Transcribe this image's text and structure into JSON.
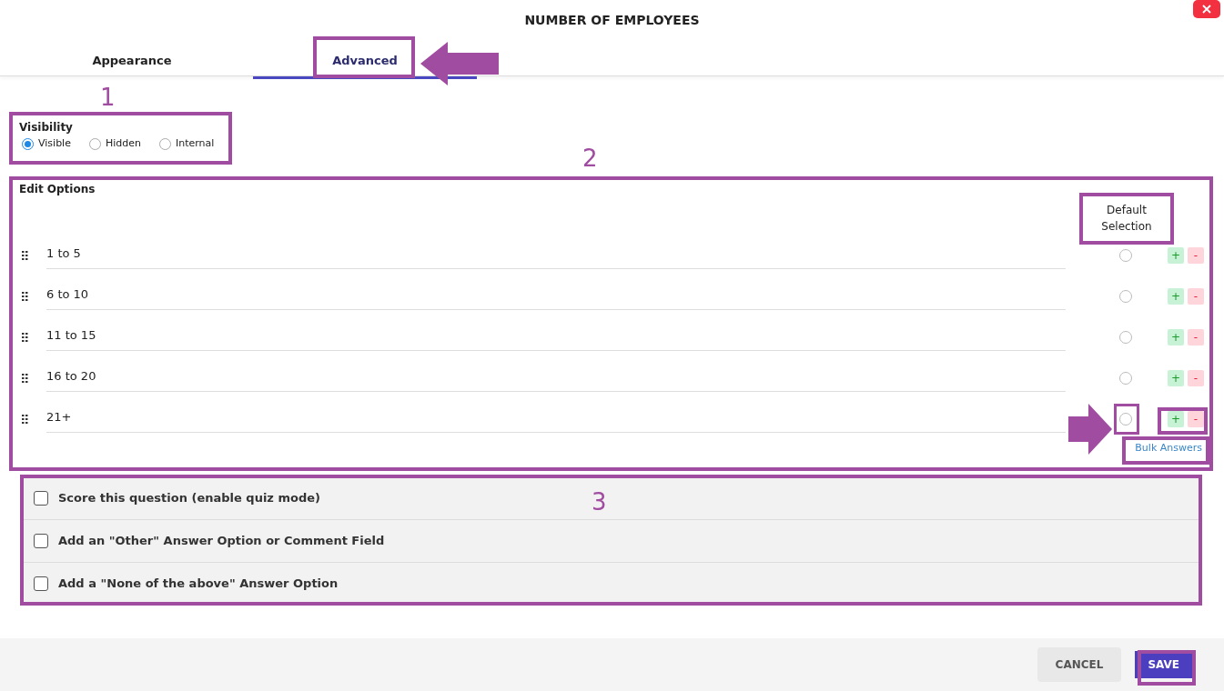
{
  "dialog": {
    "title": "NUMBER OF EMPLOYEES"
  },
  "tabs": [
    {
      "label": "Appearance",
      "selected": false
    },
    {
      "label": "Advanced",
      "selected": true
    }
  ],
  "visibility": {
    "label": "Visibility",
    "options": [
      {
        "label": "Visible",
        "selected": true
      },
      {
        "label": "Hidden",
        "selected": false
      },
      {
        "label": "Internal",
        "selected": false
      }
    ]
  },
  "edit_options": {
    "label": "Edit Options",
    "default_header": "Default Selection",
    "bulk_link": "Bulk Answers",
    "options": [
      {
        "text": "1 to 5",
        "selected": false,
        "add": "+",
        "remove": "-"
      },
      {
        "text": "6 to 10",
        "selected": false,
        "add": "+",
        "remove": "-"
      },
      {
        "text": "11 to 15",
        "selected": false,
        "add": "+",
        "remove": "-"
      },
      {
        "text": "16 to 20",
        "selected": false,
        "add": "+",
        "remove": "-"
      },
      {
        "text": "21+",
        "selected": false,
        "add": "+",
        "remove": "-"
      }
    ]
  },
  "settings": [
    {
      "label": "Score this question (enable quiz mode)",
      "checked": false
    },
    {
      "label": "Add an \"Other\" Answer Option or Comment Field",
      "checked": false
    },
    {
      "label": "Add a \"None of the above\" Answer Option",
      "checked": false
    }
  ],
  "buttons": [
    {
      "label": "CANCEL",
      "kind": "secondary"
    },
    {
      "label": "SAVE",
      "kind": "primary"
    }
  ],
  "annotations": [
    {
      "label": "1"
    },
    {
      "label": "2"
    },
    {
      "label": "3"
    }
  ]
}
